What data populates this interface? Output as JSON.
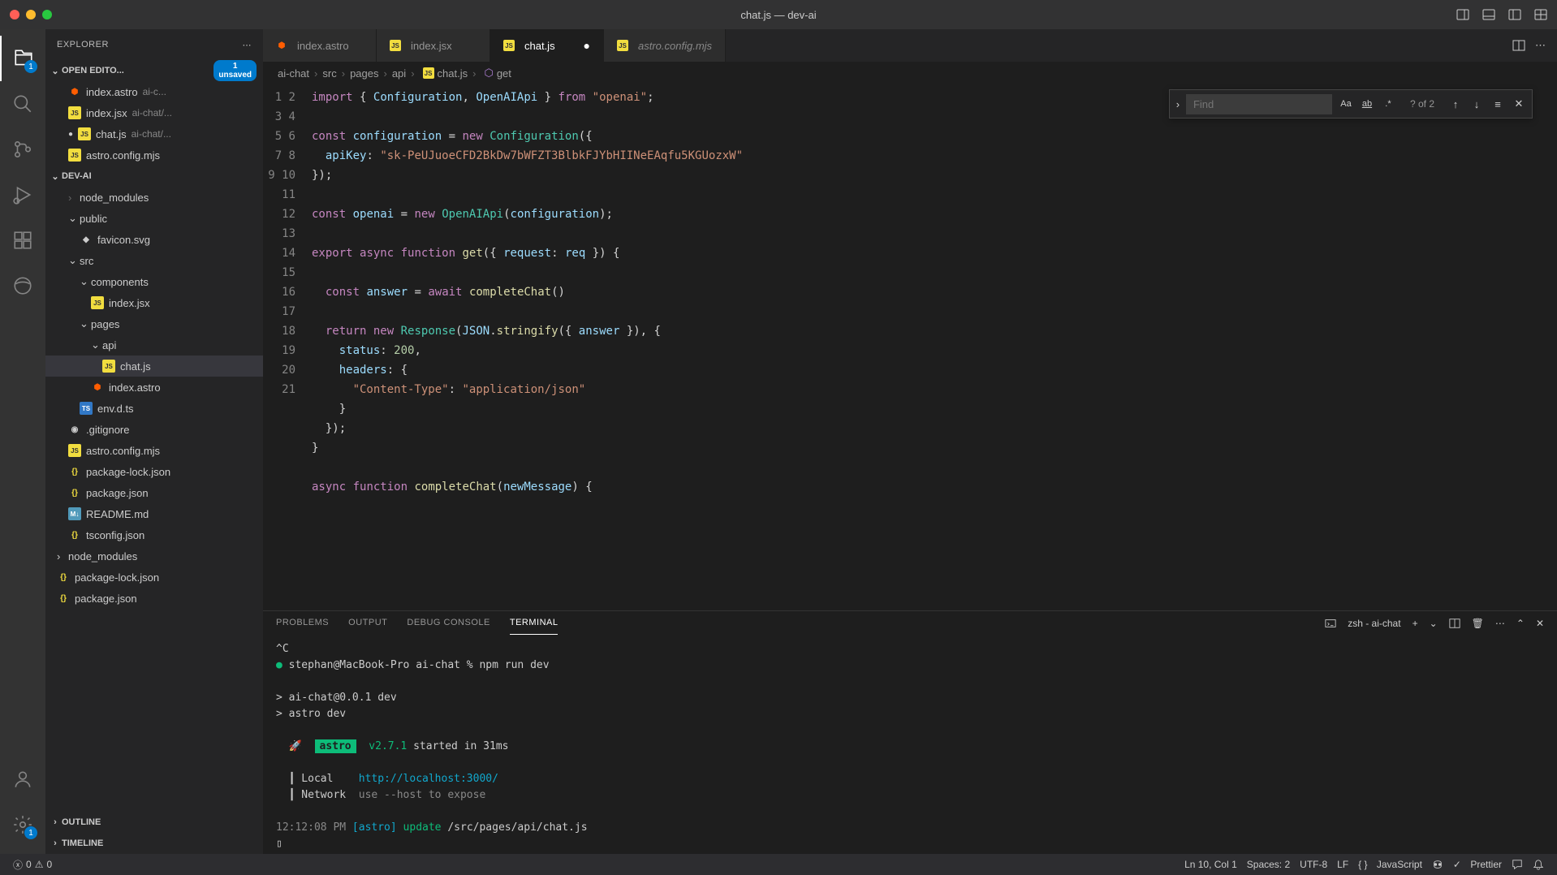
{
  "window": {
    "title": "chat.js — dev-ai"
  },
  "explorer": {
    "title": "EXPLORER",
    "sections": {
      "openEditors": {
        "label": "OPEN EDITO...",
        "unsaved_count": "1",
        "unsaved_label": "unsaved",
        "items": [
          {
            "name": "index.astro",
            "dim": "ai-c...",
            "icon": "astro"
          },
          {
            "name": "index.jsx",
            "dim": "ai-chat/...",
            "icon": "js"
          },
          {
            "name": "chat.js",
            "dim": "ai-chat/...",
            "icon": "js",
            "modified": true
          },
          {
            "name": "astro.config.mjs",
            "dim": "",
            "icon": "js"
          }
        ]
      },
      "project": {
        "label": "DEV-AI",
        "tree": [
          {
            "name": "node_modules",
            "depth": 1,
            "type": "folder-dim"
          },
          {
            "name": "public",
            "depth": 1,
            "type": "folder",
            "open": true
          },
          {
            "name": "favicon.svg",
            "depth": 2,
            "type": "file",
            "icon": "svg"
          },
          {
            "name": "src",
            "depth": 1,
            "type": "folder",
            "open": true
          },
          {
            "name": "components",
            "depth": 2,
            "type": "folder",
            "open": true
          },
          {
            "name": "index.jsx",
            "depth": 3,
            "type": "file",
            "icon": "js"
          },
          {
            "name": "pages",
            "depth": 2,
            "type": "folder",
            "open": true
          },
          {
            "name": "api",
            "depth": 3,
            "type": "folder",
            "open": true
          },
          {
            "name": "chat.js",
            "depth": 4,
            "type": "file",
            "icon": "js",
            "active": true
          },
          {
            "name": "index.astro",
            "depth": 3,
            "type": "file",
            "icon": "astro"
          },
          {
            "name": "env.d.ts",
            "depth": 2,
            "type": "file",
            "icon": "ts"
          },
          {
            "name": ".gitignore",
            "depth": 1,
            "type": "file",
            "icon": "git"
          },
          {
            "name": "astro.config.mjs",
            "depth": 1,
            "type": "file",
            "icon": "js"
          },
          {
            "name": "package-lock.json",
            "depth": 1,
            "type": "file",
            "icon": "json"
          },
          {
            "name": "package.json",
            "depth": 1,
            "type": "file",
            "icon": "json"
          },
          {
            "name": "README.md",
            "depth": 1,
            "type": "file",
            "icon": "md"
          },
          {
            "name": "tsconfig.json",
            "depth": 1,
            "type": "file",
            "icon": "json"
          },
          {
            "name": "node_modules",
            "depth": 0,
            "type": "folder"
          },
          {
            "name": "package-lock.json",
            "depth": 0,
            "type": "file",
            "icon": "json"
          },
          {
            "name": "package.json",
            "depth": 0,
            "type": "file",
            "icon": "json"
          }
        ]
      },
      "outline": {
        "label": "OUTLINE"
      },
      "timeline": {
        "label": "TIMELINE"
      }
    }
  },
  "tabs": [
    {
      "name": "index.astro",
      "icon": "astro"
    },
    {
      "name": "index.jsx",
      "icon": "js"
    },
    {
      "name": "chat.js",
      "icon": "js",
      "active": true,
      "dirty": true
    },
    {
      "name": "astro.config.mjs",
      "icon": "js",
      "italic": true
    }
  ],
  "breadcrumbs": [
    "ai-chat",
    "src",
    "pages",
    "api",
    "chat.js",
    "get"
  ],
  "find": {
    "placeholder": "Find",
    "results": "? of 2"
  },
  "code": {
    "lines": [
      {
        "n": 1,
        "html": "<span class='kw'>import</span> <span class='pn'>{</span> <span class='var'>Configuration</span><span class='pn'>,</span> <span class='var'>OpenAIApi</span> <span class='pn'>}</span> <span class='kw'>from</span> <span class='str'>\"openai\"</span><span class='pn'>;</span>"
      },
      {
        "n": 2,
        "html": ""
      },
      {
        "n": 3,
        "html": "<span class='kw'>const</span> <span class='var'>configuration</span> <span class='pn'>=</span> <span class='kw'>new</span> <span class='cls'>Configuration</span><span class='pn'>({</span>"
      },
      {
        "n": 4,
        "html": "  <span class='prop'>apiKey</span><span class='pn'>:</span> <span class='str'>\"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\"</span>"
      },
      {
        "n": 5,
        "html": "<span class='pn'>});</span>"
      },
      {
        "n": 6,
        "html": ""
      },
      {
        "n": 7,
        "html": "<span class='kw'>const</span> <span class='var'>openai</span> <span class='pn'>=</span> <span class='kw'>new</span> <span class='cls'>OpenAIApi</span><span class='pn'>(</span><span class='var'>configuration</span><span class='pn'>);</span>"
      },
      {
        "n": 8,
        "html": ""
      },
      {
        "n": 9,
        "html": "<span class='kw'>export</span> <span class='kw'>async</span> <span class='kw'>function</span> <span class='fn'>get</span><span class='pn'>({</span> <span class='var'>request</span><span class='pn'>:</span> <span class='var'>req</span> <span class='pn'>}) {</span>"
      },
      {
        "n": 10,
        "html": ""
      },
      {
        "n": 11,
        "html": "  <span class='kw'>const</span> <span class='var'>answer</span> <span class='pn'>=</span> <span class='kw'>await</span> <span class='fn'>completeChat</span><span class='pn'>()</span>"
      },
      {
        "n": 12,
        "html": ""
      },
      {
        "n": 13,
        "html": "  <span class='kw'>return</span> <span class='kw'>new</span> <span class='cls'>Response</span><span class='pn'>(</span><span class='var'>JSON</span><span class='pn'>.</span><span class='fn'>stringify</span><span class='pn'>({</span> <span class='var'>answer</span> <span class='pn'>}), {</span>"
      },
      {
        "n": 14,
        "html": "    <span class='prop'>status</span><span class='pn'>:</span> <span class='num'>200</span><span class='pn'>,</span>"
      },
      {
        "n": 15,
        "html": "    <span class='prop'>headers</span><span class='pn'>: {</span>"
      },
      {
        "n": 16,
        "html": "      <span class='str'>\"Content-Type\"</span><span class='pn'>:</span> <span class='str'>\"application/json\"</span>"
      },
      {
        "n": 17,
        "html": "    <span class='pn'>}</span>"
      },
      {
        "n": 18,
        "html": "  <span class='pn'>});</span>"
      },
      {
        "n": 19,
        "html": "<span class='pn'>}</span>"
      },
      {
        "n": 20,
        "html": ""
      },
      {
        "n": 21,
        "html": "<span class='kw'>async</span> <span class='kw'>function</span> <span class='fn'>completeChat</span><span class='pn'>(</span><span class='var'>newMessage</span><span class='pn'>) {</span>"
      }
    ]
  },
  "panel": {
    "tabs": [
      "PROBLEMS",
      "OUTPUT",
      "DEBUG CONSOLE",
      "TERMINAL"
    ],
    "active": "TERMINAL",
    "terminal_name": "zsh - ai-chat",
    "terminal_lines": [
      {
        "html": "^C"
      },
      {
        "html": "<span class='term-green'>●</span> stephan@MacBook-Pro ai-chat % npm run dev"
      },
      {
        "html": ""
      },
      {
        "html": "> ai-chat@0.0.1 dev"
      },
      {
        "html": "> astro dev"
      },
      {
        "html": ""
      },
      {
        "html": "  🚀  <span class='term-badge'>astro</span>  <span class='term-green'>v2.7.1</span> started in 31ms"
      },
      {
        "html": ""
      },
      {
        "html": "  ┃ Local    <span class='term-cyan'>http://localhost:3000/</span>"
      },
      {
        "html": "  ┃ Network  <span class='term-dim'>use --host to expose</span>"
      },
      {
        "html": ""
      },
      {
        "html": "<span class='term-dim'>12:12:08 PM</span> <span class='term-cyan'>[astro]</span> <span class='term-green'>update</span> /src/pages/api/chat.js"
      },
      {
        "html": "▯"
      }
    ]
  },
  "statusbar": {
    "errors": "0",
    "warnings": "0",
    "cursor": "Ln 10, Col 1",
    "spaces": "Spaces: 2",
    "encoding": "UTF-8",
    "eol": "LF",
    "language": "JavaScript",
    "prettier": "Prettier"
  },
  "activity_badges": {
    "explorer": "1",
    "settings": "1"
  }
}
